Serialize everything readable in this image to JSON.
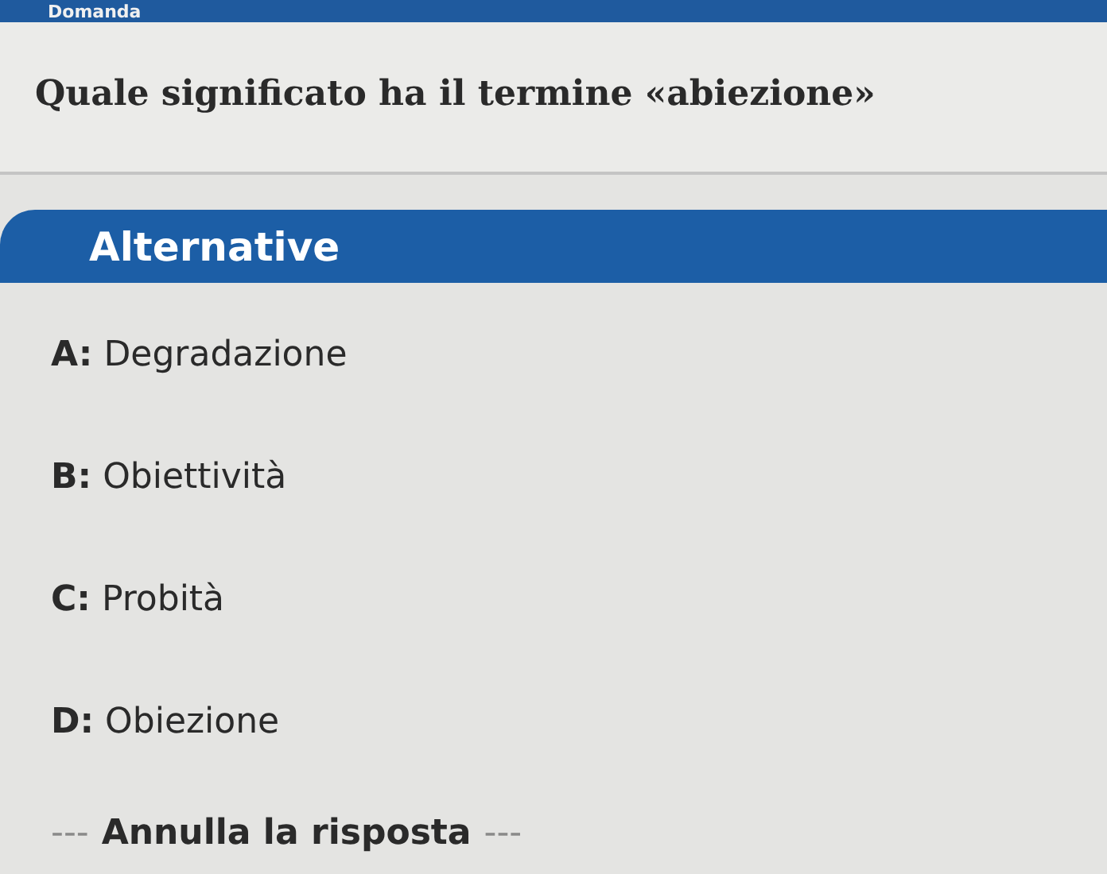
{
  "header": {
    "title": "Domanda"
  },
  "question": "Quale significato ha il termine «abiezione»",
  "section": {
    "title": "Alternative"
  },
  "options": [
    {
      "text": "**A:** Degradazione"
    },
    {
      "text": "**B:** Obiettività"
    },
    {
      "text": "**C:** Probità"
    },
    {
      "text": "**D:** Obiezione"
    }
  ],
  "cancel": {
    "dashes_left": "---",
    "label": "Annulla la risposta",
    "dashes_right": "---"
  }
}
